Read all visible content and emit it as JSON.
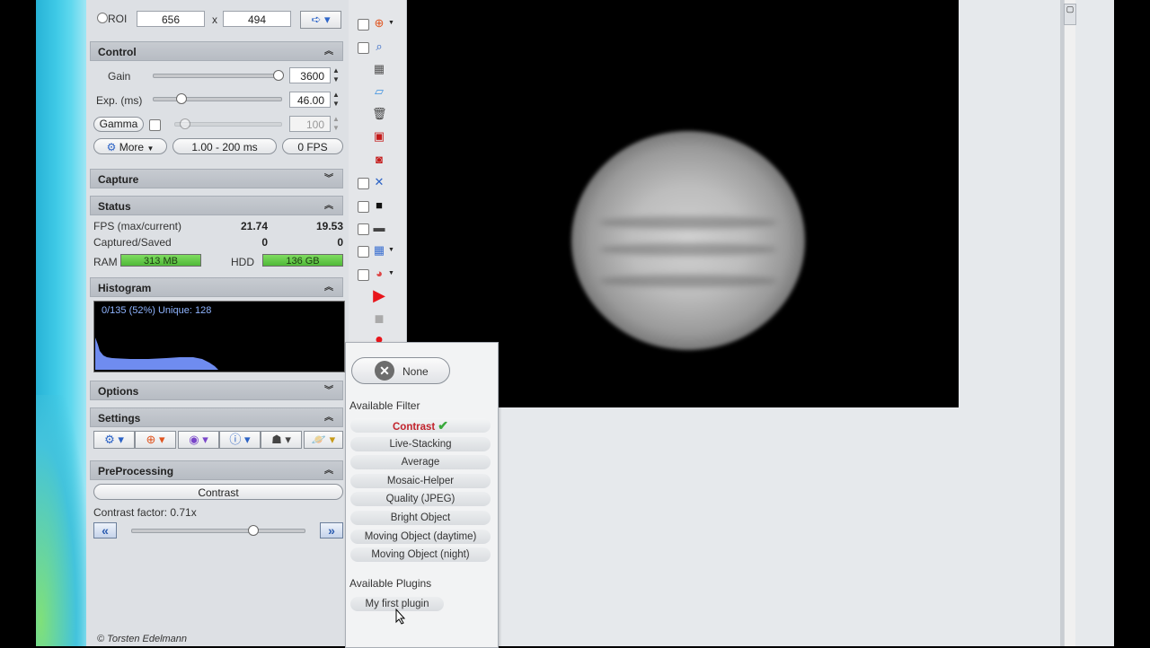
{
  "roi": {
    "label": "ROI",
    "width": "656",
    "x_sep": "x",
    "height": "494"
  },
  "control": {
    "title": "Control",
    "gain_label": "Gain",
    "gain_value": "3600",
    "exp_label": "Exp. (ms)",
    "exp_value": "46.00",
    "gamma_label": "Gamma",
    "gamma_value": "100",
    "more_label": "More",
    "range_label": "1.00 - 200 ms",
    "fps_label": "0 FPS"
  },
  "capture": {
    "title": "Capture"
  },
  "status": {
    "title": "Status",
    "fps_label": "FPS (max/current)",
    "fps_max": "21.74",
    "fps_current": "19.53",
    "captured_label": "Captured/Saved",
    "captured": "0",
    "saved": "0",
    "ram_label": "RAM",
    "ram_value": "313 MB",
    "hdd_label": "HDD",
    "hdd_value": "136 GB"
  },
  "histogram": {
    "title": "Histogram",
    "info": "0/135 (52%)  Unique: 128"
  },
  "options": {
    "title": "Options"
  },
  "settings": {
    "title": "Settings"
  },
  "preprocessing": {
    "title": "PreProcessing",
    "filter_button": "Contrast",
    "factor_label": "Contrast factor: 0.71x",
    "factor_level": 0.71
  },
  "copyright": "© Torsten Edelmann",
  "popup": {
    "none_label": "None",
    "filters_title": "Available Filter",
    "filters": [
      {
        "label": "Contrast",
        "active": true
      },
      {
        "label": "Live-Stacking",
        "active": false
      },
      {
        "label": "Average",
        "active": false
      },
      {
        "label": "Mosaic-Helper",
        "active": false
      },
      {
        "label": "Quality (JPEG)",
        "active": false
      },
      {
        "label": "Bright Object",
        "active": false
      },
      {
        "label": "Moving Object (daytime)",
        "active": false
      },
      {
        "label": "Moving Object (night)",
        "active": false
      }
    ],
    "plugins_title": "Available Plugins",
    "plugins": [
      "My first plugin"
    ]
  },
  "colors": {
    "meter_green": "#4fb838",
    "active_filter": "#c2232c",
    "check_green": "#39a93c",
    "record_red": "#e8151b"
  }
}
